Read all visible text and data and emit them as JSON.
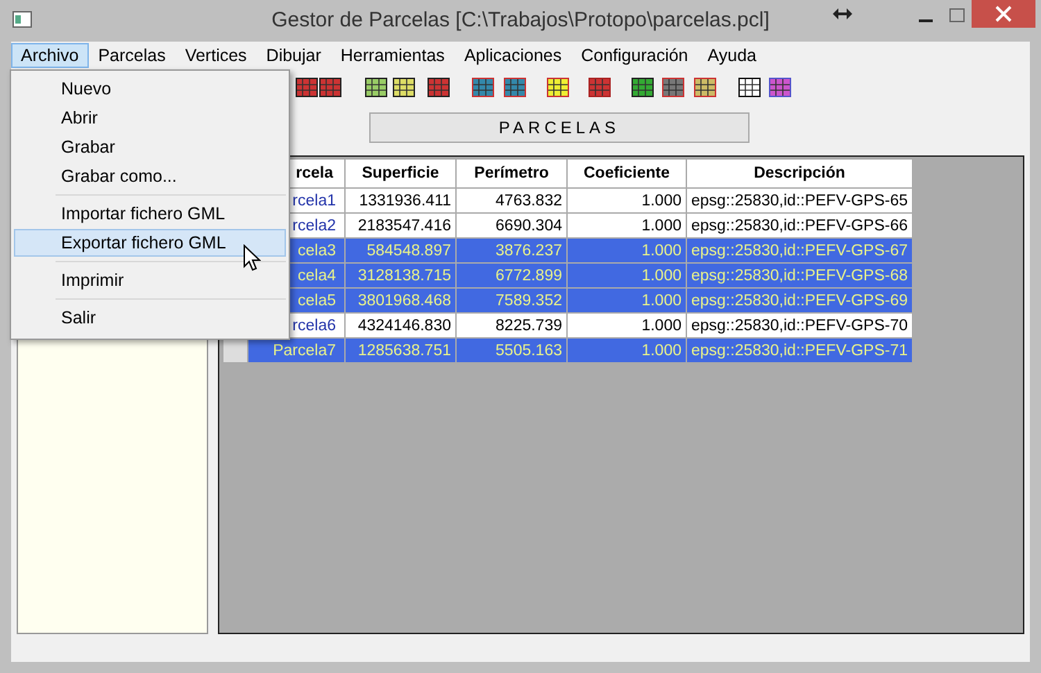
{
  "window": {
    "title": "Gestor de Parcelas  [C:\\Trabajos\\Protopo\\parcelas.pcl]"
  },
  "menu_bar": [
    {
      "label": "Archivo",
      "selected": true
    },
    {
      "label": "Parcelas",
      "selected": false
    },
    {
      "label": "Vertices",
      "selected": false
    },
    {
      "label": "Dibujar",
      "selected": false
    },
    {
      "label": "Herramientas",
      "selected": false
    },
    {
      "label": "Aplicaciones",
      "selected": false
    },
    {
      "label": "Configuración",
      "selected": false
    },
    {
      "label": "Ayuda",
      "selected": false
    }
  ],
  "file_menu": [
    {
      "kind": "item",
      "label": "Nuevo",
      "selected": false
    },
    {
      "kind": "item",
      "label": "Abrir",
      "selected": false
    },
    {
      "kind": "item",
      "label": "Grabar",
      "selected": false
    },
    {
      "kind": "item",
      "label": "Grabar como...",
      "selected": false
    },
    {
      "kind": "separator"
    },
    {
      "kind": "item",
      "label": "Importar fichero GML",
      "selected": false
    },
    {
      "kind": "item",
      "label": "Exportar fichero GML",
      "selected": true
    },
    {
      "kind": "separator"
    },
    {
      "kind": "item",
      "label": "Imprimir",
      "selected": false
    },
    {
      "kind": "separator"
    },
    {
      "kind": "item",
      "label": "Salir",
      "selected": false
    }
  ],
  "panel_button": "PARCELAS",
  "table": {
    "columns": [
      "rcela",
      "Superficie",
      "Perímetro",
      "Coeficiente",
      "Descripción"
    ],
    "rows": [
      {
        "cells": [
          "rcela1",
          "1331936.411",
          "4763.832",
          "1.000",
          "epsg::25830,id::PEFV-GPS-65"
        ],
        "selected": false
      },
      {
        "cells": [
          "rcela2",
          "2183547.416",
          "6690.304",
          "1.000",
          "epsg::25830,id::PEFV-GPS-66"
        ],
        "selected": false
      },
      {
        "cells": [
          "cela3",
          "584548.897",
          "3876.237",
          "1.000",
          "epsg::25830,id::PEFV-GPS-67"
        ],
        "selected": true
      },
      {
        "cells": [
          "cela4",
          "3128138.715",
          "6772.899",
          "1.000",
          "epsg::25830,id::PEFV-GPS-68"
        ],
        "selected": true
      },
      {
        "cells": [
          "cela5",
          "3801968.468",
          "7589.352",
          "1.000",
          "epsg::25830,id::PEFV-GPS-69"
        ],
        "selected": true
      },
      {
        "cells": [
          "rcela6",
          "4324146.830",
          "8225.739",
          "1.000",
          "epsg::25830,id::PEFV-GPS-70"
        ],
        "selected": false
      },
      {
        "cells": [
          "Parcela7",
          "1285638.751",
          "5505.163",
          "1.000",
          "epsg::25830,id::PEFV-GPS-71"
        ],
        "selected": true
      }
    ]
  }
}
